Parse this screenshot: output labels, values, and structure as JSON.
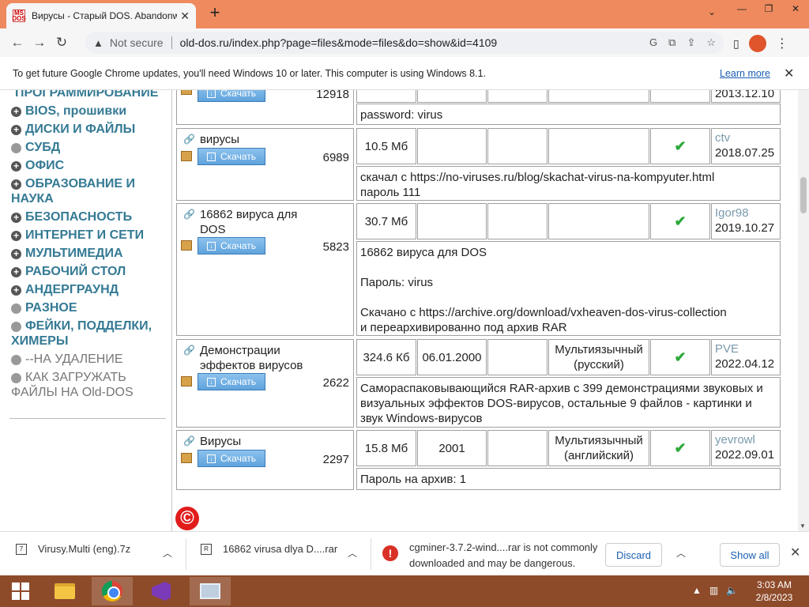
{
  "browser": {
    "tab_title": "Вирусы - Старый DOS. Abandonware",
    "favicon_text": "MS DOS",
    "address": {
      "security_label": "Not secure",
      "url": "old-dos.ru/index.php?page=files&mode=files&do=show&id=4109"
    },
    "profile_initial": "",
    "infobar": {
      "message": "To get future Google Chrome updates, you'll need Windows 10 or later. This computer is using Windows 8.1.",
      "link": "Learn more"
    }
  },
  "sidebar": {
    "items": [
      {
        "label": "ПРОГРАММИРОВАНИЕ",
        "bullet": ""
      },
      {
        "label": "BIOS, прошивки",
        "bullet": "+"
      },
      {
        "label": "ДИСКИ И ФАЙЛЫ",
        "bullet": "+"
      },
      {
        "label": "СУБД",
        "bullet": "o"
      },
      {
        "label": "ОФИС",
        "bullet": "+"
      },
      {
        "label": "ОБРАЗОВАНИЕ И НАУКА",
        "bullet": "+"
      },
      {
        "label": "БЕЗОПАСНОСТЬ",
        "bullet": "+"
      },
      {
        "label": "ИНТЕРНЕТ И СЕТИ",
        "bullet": "+"
      },
      {
        "label": "МУЛЬТИМЕДИА",
        "bullet": "+"
      },
      {
        "label": "РАБОЧИЙ СТОЛ",
        "bullet": "+"
      },
      {
        "label": "АНДЕРГРАУНД",
        "bullet": "+"
      },
      {
        "label": "РАЗНОЕ",
        "bullet": "o"
      },
      {
        "label": "ФЕЙКИ, ПОДДЕЛКИ, ХИМЕРЫ",
        "bullet": "o"
      },
      {
        "label": "--НА УДАЛЕНИЕ",
        "bullet": "o"
      },
      {
        "label": "КАК ЗАГРУЖАТЬ ФАЙЛЫ НА Old-DOS",
        "bullet": "o"
      }
    ]
  },
  "files": {
    "download_label": "Скачать",
    "rows": [
      {
        "name": "",
        "count": "12918",
        "size": "",
        "date": "",
        "lang": "",
        "check": "",
        "user": "",
        "added": "2013.12.10",
        "desc": "password: virus"
      },
      {
        "name": "вирусы",
        "count": "6989",
        "size": "10.5 Мб",
        "date": "",
        "lang": "",
        "check": "✔",
        "user": "ctv",
        "added": "2018.07.25",
        "desc": "скачал с https://no-viruses.ru/blog/skachat-virus-na-kompyuter.html\nпароль 111"
      },
      {
        "name": "16862 вируса для DOS",
        "count": "5823",
        "size": "30.7 Мб",
        "date": "",
        "lang": "",
        "check": "✔",
        "user": "Igor98",
        "added": "2019.10.27",
        "desc": "16862 вируса для DOS\n\nПароль: virus\n\nСкачано с https://archive.org/download/vxheaven-dos-virus-collection\nи переархивированно под архив RAR"
      },
      {
        "name": "Демонстрации эффектов вирусов",
        "count": "2622",
        "size": "324.6 Кб",
        "date": "06.01.2000",
        "lang": "Мультиязычный (русский)",
        "check": "✔",
        "user": "PVE",
        "added": "2022.04.12",
        "desc": "Самораспаковывающийся RAR-архив с 399 демонстрациями звуковых и визуальных эффектов DOS-вирусов, остальные 9 файлов - картинки и звук Windows-вирусов"
      },
      {
        "name": "Вирусы",
        "count": "2297",
        "size": "15.8 Мб",
        "date": "2001",
        "lang": "Мультиязычный (английский)",
        "check": "✔",
        "user": "yevrowl",
        "added": "2022.09.01",
        "desc": "Пароль на архив: 1"
      }
    ]
  },
  "copyright_glyph": "©",
  "downloads": {
    "items": [
      {
        "name": "Virusy.Multi (eng).7z"
      },
      {
        "name": "16862 virusa dlya D....rar"
      }
    ],
    "warning": {
      "text": "cgminer-3.7.2-wind....rar is not commonly downloaded and may be dangerous.",
      "discard": "Discard"
    },
    "show_all": "Show all"
  },
  "taskbar": {
    "time": "3:03 AM",
    "date": "2/8/2023"
  },
  "colors": {
    "tabstrip": "#ee8a5d",
    "taskbar": "#8e4b2a",
    "menu_link": "#357a94",
    "check": "#2eaa3a"
  }
}
